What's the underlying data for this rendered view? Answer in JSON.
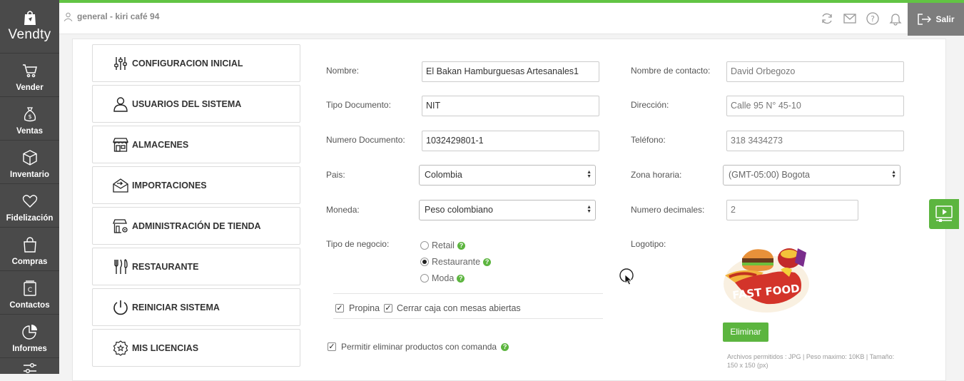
{
  "app": {
    "brand": "Vendty"
  },
  "header": {
    "user_label": "general - kiri café 94",
    "logout_label": "Salir"
  },
  "sidebar": {
    "items": [
      {
        "label": "Vender",
        "icon": "cart-icon"
      },
      {
        "label": "Ventas",
        "icon": "money-bag-icon"
      },
      {
        "label": "Inventario",
        "icon": "box-icon"
      },
      {
        "label": "Fidelización",
        "icon": "heart-icon"
      },
      {
        "label": "Compras",
        "icon": "shopping-bag-icon"
      },
      {
        "label": "Contactos",
        "icon": "contacts-icon"
      },
      {
        "label": "Informes",
        "icon": "pie-chart-icon"
      }
    ]
  },
  "settings_menu": [
    {
      "label": "CONFIGURACION INICIAL",
      "icon": "sliders-icon"
    },
    {
      "label": "USUARIOS DEL SISTEMA",
      "icon": "user-icon"
    },
    {
      "label": "ALMACENES",
      "icon": "store-icon"
    },
    {
      "label": "IMPORTACIONES",
      "icon": "import-icon"
    },
    {
      "label": "ADMINISTRACIÓN DE TIENDA",
      "icon": "store-settings-icon"
    },
    {
      "label": "RESTAURANTE",
      "icon": "cutlery-icon"
    },
    {
      "label": "REINICIAR SISTEMA",
      "icon": "power-icon"
    },
    {
      "label": "MIS LICENCIAS",
      "icon": "badge-icon"
    }
  ],
  "form": {
    "nombre": {
      "label": "Nombre:",
      "value": "El Bakan Hamburguesas Artesanales1"
    },
    "tipo_documento": {
      "label": "Tipo Documento:",
      "value": "NIT"
    },
    "numero_documento": {
      "label": "Numero Documento:",
      "value": "1032429801-1"
    },
    "pais": {
      "label": "Pais:",
      "value": "Colombia"
    },
    "moneda": {
      "label": "Moneda:",
      "value": "Peso colombiano"
    },
    "tipo_negocio": {
      "label": "Tipo de negocio:",
      "options": [
        {
          "label": "Retail",
          "selected": false
        },
        {
          "label": "Restaurante",
          "selected": true
        },
        {
          "label": "Moda",
          "selected": false
        }
      ]
    },
    "propina": {
      "label": "Propina",
      "checked": true
    },
    "cerrar_caja": {
      "label": "Cerrar caja con mesas abiertas",
      "checked": true
    },
    "permitir_eliminar": {
      "label": "Permitir eliminar productos con comanda",
      "checked": true
    },
    "nombre_contacto": {
      "label": "Nombre de contacto:",
      "value": "David Orbegozo"
    },
    "direccion": {
      "label": "Dirección:",
      "value": "Calle 95 N° 45-10"
    },
    "telefono": {
      "label": "Teléfono:",
      "value": "318 3434273"
    },
    "zona_horaria": {
      "label": "Zona horaria:",
      "value": "(GMT-05:00) Bogota"
    },
    "numero_decimales": {
      "label": "Numero decimales:",
      "value": "2"
    },
    "logotipo": {
      "label": "Logotipo:",
      "image_text": "FAST FOOD"
    },
    "eliminar_label": "Eliminar",
    "file_note": "Archivos permitidos : JPG | Peso maximo: 10KB | Tamaño: 150 x 150 (px)"
  },
  "colors": {
    "accent": "#5cb53f",
    "sidebar": "#4a4a4a",
    "logout": "#7d7d7d"
  }
}
